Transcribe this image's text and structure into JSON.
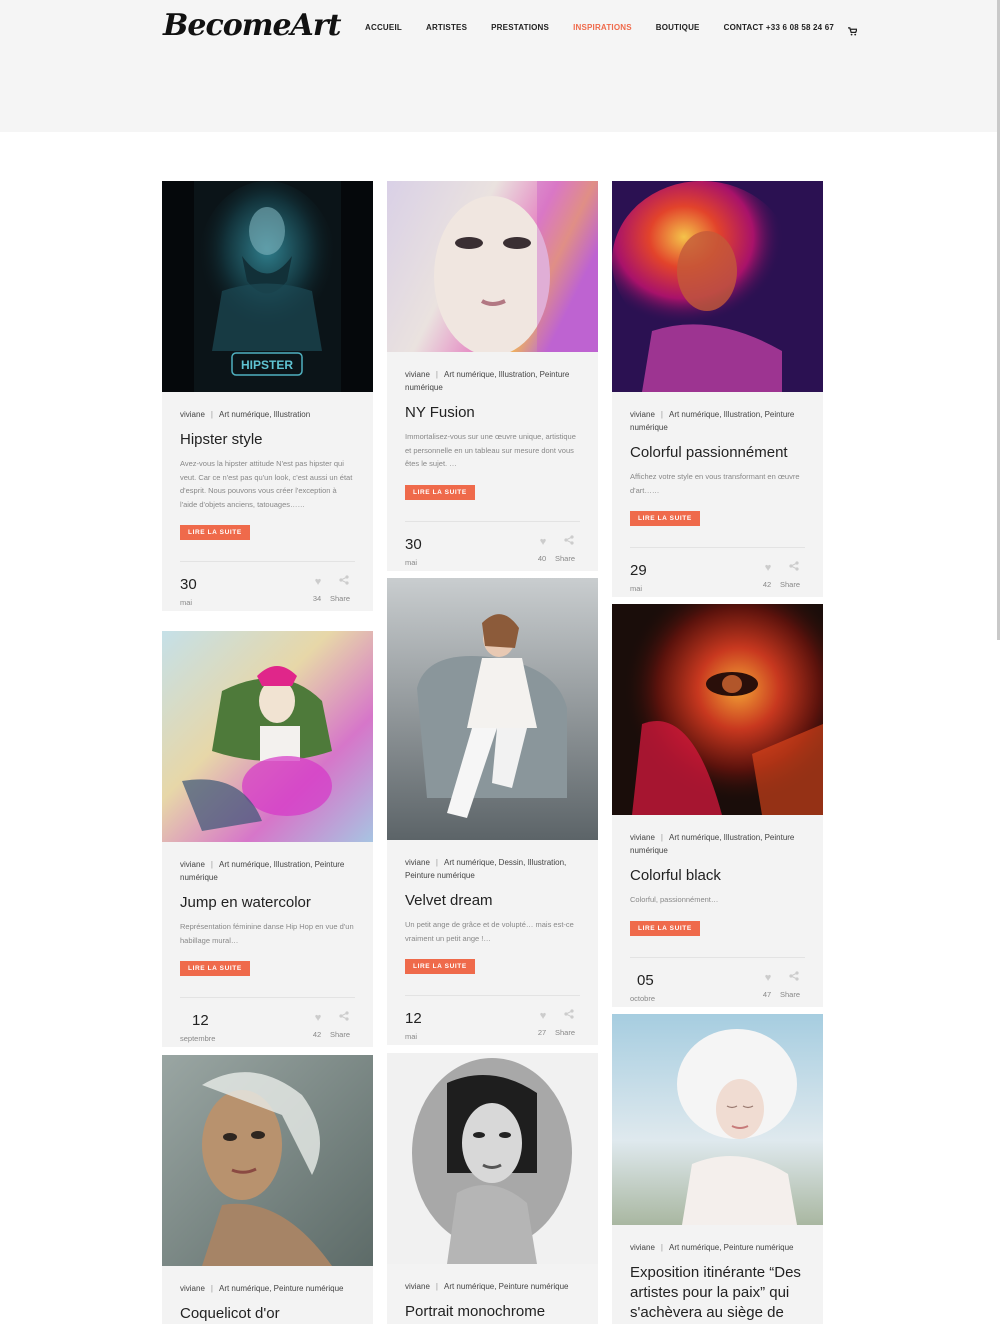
{
  "brand": {
    "logo": "BecomeArt",
    "accent": "#ef6a4b"
  },
  "nav": {
    "items": [
      "ACCUEIL",
      "ARTISTES",
      "PRESTATIONS",
      "INSPIRATIONS",
      "BOUTIQUE",
      "CONTACT +33 6 08 58 24 67"
    ],
    "active": "INSPIRATIONS",
    "cart_icon": "cart-icon"
  },
  "cards": [
    {
      "author": "viviane",
      "cats": "Art numérique, Illustration",
      "title": "Hipster style",
      "excerpt": "Avez-vous la hipster attitude N'est pas hipster qui veut. Car ce n'est pas qu'un look, c'est aussi un état d'esprit. Nous pouvons vous créer l'exception à l'aide d'objets anciens, tatouages……",
      "button": "LIRE LA SUITE",
      "day": "30",
      "month": "mai",
      "likes": "34",
      "share": "Share",
      "image_text": "HIPSTER"
    },
    {
      "author": "viviane",
      "cats": "Art numérique, Illustration, Peinture numérique",
      "title": "NY Fusion",
      "excerpt": "Immortalisez-vous sur une œuvre unique, artistique et personnelle en un tableau sur mesure dont vous êtes le sujet. …",
      "button": "LIRE LA SUITE",
      "day": "30",
      "month": "mai",
      "likes": "40",
      "share": "Share"
    },
    {
      "author": "viviane",
      "cats": "Art numérique, Illustration, Peinture numérique",
      "title": "Colorful passionnément",
      "excerpt": "Affichez votre style en vous transformant en œuvre d'art……",
      "button": "LIRE LA SUITE",
      "day": "29",
      "month": "mai",
      "likes": "42",
      "share": "Share"
    },
    {
      "author": "viviane",
      "cats": "Art numérique, Illustration, Peinture numérique",
      "title": "Jump en watercolor",
      "excerpt": "Représentation féminine danse Hip Hop en vue d'un habillage mural…",
      "button": "LIRE LA SUITE",
      "day": "12",
      "month": "septembre",
      "likes": "42",
      "share": "Share"
    },
    {
      "author": "viviane",
      "cats": "Art numérique, Dessin, Illustration, Peinture numérique",
      "title": "Velvet dream",
      "excerpt": "Un petit ange de grâce et de volupté… mais est-ce vraiment un petit ange !…",
      "button": "LIRE LA SUITE",
      "day": "12",
      "month": "mai",
      "likes": "27",
      "share": "Share"
    },
    {
      "author": "viviane",
      "cats": "Art numérique, Illustration, Peinture numérique",
      "title": "Colorful black",
      "excerpt": "Colorful, passionnément…",
      "button": "LIRE LA SUITE",
      "day": "05",
      "month": "octobre",
      "likes": "47",
      "share": "Share"
    },
    {
      "author": "viviane",
      "cats": "Art numérique, Peinture numérique",
      "title": "Coquelicot d'or"
    },
    {
      "author": "viviane",
      "cats": "Art numérique, Peinture numérique",
      "title": "Portrait monochrome"
    },
    {
      "author": "viviane",
      "cats": "Art numérique, Peinture numérique",
      "title": "Exposition itinérante “Des artistes pour la paix” qui s'achèvera au siège de"
    }
  ]
}
